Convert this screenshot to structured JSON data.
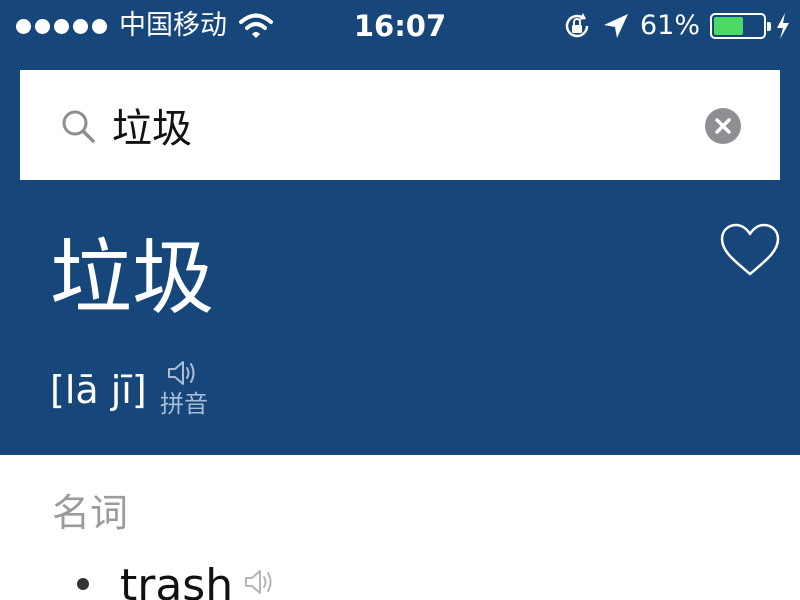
{
  "status_bar": {
    "carrier": "中国移动",
    "time": "16:07",
    "battery_percent": "61%",
    "battery_level": 0.61,
    "signal_bars": 5,
    "icons": [
      "wifi-icon",
      "orientation-lock-icon",
      "location-arrow-icon",
      "battery-icon",
      "charging-bolt-icon"
    ]
  },
  "search": {
    "value": "垃圾",
    "icon": "search-icon",
    "clear_icon": "clear-icon"
  },
  "entry": {
    "headword": "垃圾",
    "pinyin": "[lā jī]",
    "pinyin_label": "拼音",
    "favorite_icon": "heart-icon"
  },
  "definitions": {
    "part_of_speech": "名词",
    "items": [
      {
        "text": "trash",
        "audio_icon": "speaker-icon"
      }
    ]
  },
  "colors": {
    "header_bg": "#16467a",
    "battery_fill": "#4cd964",
    "muted_text": "#9b9b9b"
  }
}
